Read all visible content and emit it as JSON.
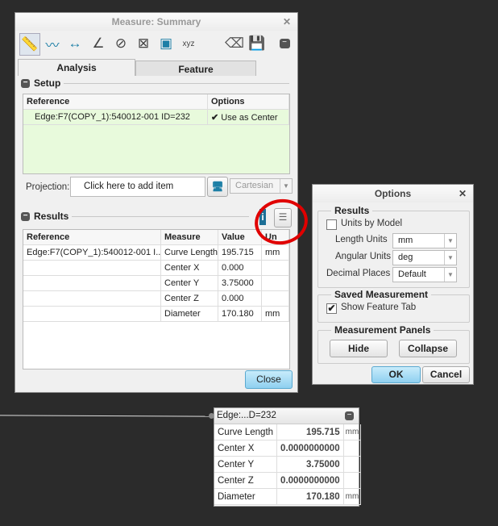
{
  "measure": {
    "title": "Measure: Summary",
    "toolbar_icons": [
      "ruler-icon",
      "curve-icon",
      "distance-icon",
      "angle-icon",
      "diameter-icon",
      "transform-icon",
      "volume-icon",
      "coordinates-icon",
      "eraser-icon",
      "save-icon",
      "collapse-icon"
    ],
    "tabs": [
      "Analysis",
      "Feature"
    ],
    "setup": {
      "header": "Setup",
      "columns": [
        "Reference",
        "Options"
      ],
      "rows": [
        {
          "reference": "Edge:F7(COPY_1):540012-001 ID=232",
          "option": "Use as Center",
          "checked": true
        }
      ]
    },
    "projection": {
      "label": "Projection:",
      "placeholder": "Click here to add item",
      "mode": "Cartesian"
    },
    "results": {
      "header": "Results",
      "columns": [
        "Reference",
        "Measure",
        "Value",
        "Un"
      ],
      "rows": [
        {
          "reference": "Edge:F7(COPY_1):540012-001 I...",
          "measure": "Curve Length",
          "value": "195.715",
          "unit": "mm"
        },
        {
          "reference": "",
          "measure": "Center X",
          "value": "0.000",
          "unit": ""
        },
        {
          "reference": "",
          "measure": "Center Y",
          "value": "3.75000",
          "unit": ""
        },
        {
          "reference": "",
          "measure": "Center Z",
          "value": "0.000",
          "unit": ""
        },
        {
          "reference": "",
          "measure": "Diameter",
          "value": "170.180",
          "unit": "mm"
        }
      ]
    },
    "close": "Close"
  },
  "options": {
    "title": "Options",
    "results_group": "Results",
    "units_by_model": "Units by Model",
    "length_label": "Length Units",
    "length": "mm",
    "angular_label": "Angular Units",
    "angular": "deg",
    "decimal_label": "Decimal Places",
    "decimal": "Default",
    "saved_group": "Saved Measurement",
    "show_feature": "Show Feature Tab",
    "panels_group": "Measurement Panels",
    "hide": "Hide",
    "collapse": "Collapse",
    "ok": "OK",
    "cancel": "Cancel"
  },
  "popup": {
    "title": "Edge:...D=232",
    "rows": [
      {
        "label": "Curve Length",
        "value": "195.715",
        "unit": "mm"
      },
      {
        "label": "Center X",
        "value": "0.0000000000",
        "unit": ""
      },
      {
        "label": "Center Y",
        "value": "3.75000",
        "unit": ""
      },
      {
        "label": "Center Z",
        "value": "0.0000000000",
        "unit": ""
      },
      {
        "label": "Diameter",
        "value": "170.180",
        "unit": "mm"
      }
    ]
  },
  "colors": {
    "highlight": "#e8fadc",
    "accent": "#1d7fa6",
    "annotation": "#e00000",
    "ok": "#8fd0f0"
  }
}
